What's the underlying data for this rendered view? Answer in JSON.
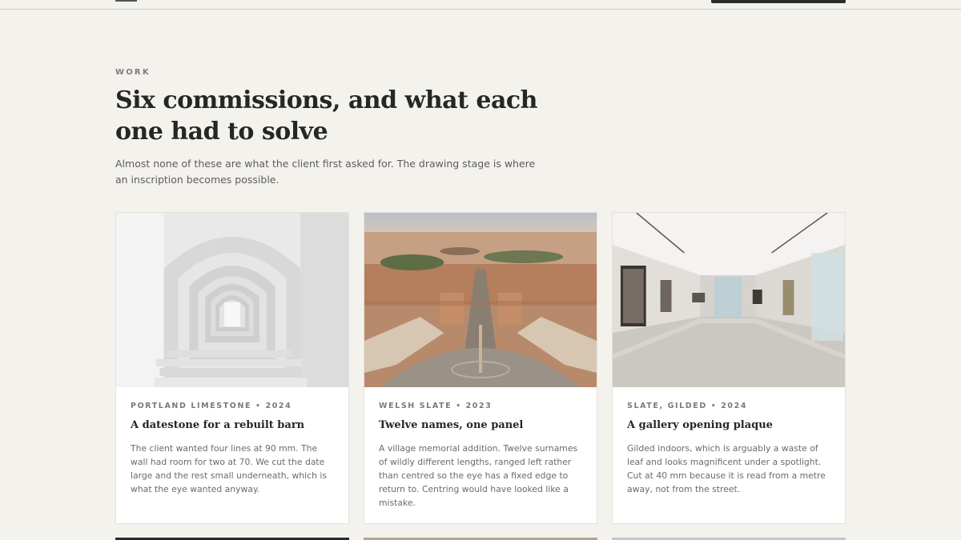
{
  "section": {
    "eyebrow": "WORK",
    "heading": "Six commissions, and what each one had to solve",
    "intro": "Almost none of these are what the client first asked for. The drawing stage is where an inscription becomes possible."
  },
  "cards": [
    {
      "material": "PORTLAND LIMESTONE",
      "year": "2024",
      "title": "A datestone for a rebuilt barn",
      "description": "The client wanted four lines at 90 mm. The wall had room for two at 70. We cut the date large and the rest small underneath, which is what the eye wanted anyway."
    },
    {
      "material": "WELSH SLATE",
      "year": "2023",
      "title": "Twelve names, one panel",
      "description": "A village memorial addition. Twelve surnames of wildly different lengths, ranged left rather than centred so the eye has a fixed edge to return to. Centring would have looked like a mistake."
    },
    {
      "material": "SLATE, GILDED",
      "year": "2024",
      "title": "A gallery opening plaque",
      "description": "Gilded indoors, which is arguably a waste of leaf and looks magnificent under a spotlight. Cut at 40 mm because it is read from a metre away, not from the street."
    }
  ],
  "separator": "•"
}
